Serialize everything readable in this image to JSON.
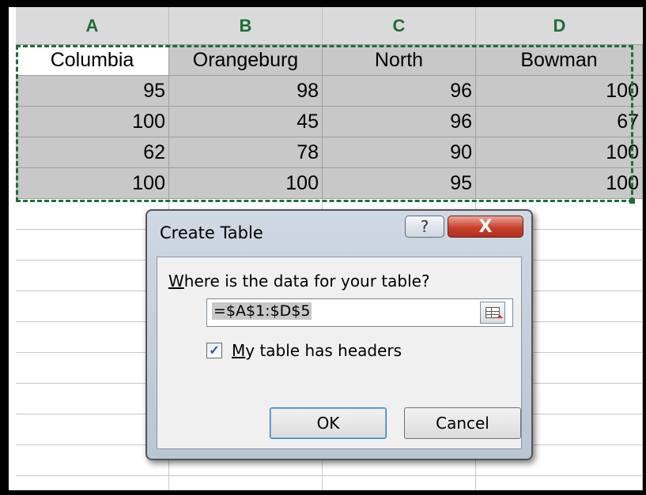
{
  "columns": [
    "A",
    "B",
    "C",
    "D"
  ],
  "table": {
    "headers": [
      "Columbia",
      "Orangeburg",
      "North",
      "Bowman"
    ],
    "rows": [
      [
        "95",
        "98",
        "96",
        "100"
      ],
      [
        "100",
        "45",
        "96",
        "67"
      ],
      [
        "62",
        "78",
        "90",
        "100"
      ],
      [
        "100",
        "100",
        "95",
        "100"
      ]
    ]
  },
  "dialog": {
    "title": "Create Table",
    "help_glyph": "?",
    "close_glyph": "X",
    "prompt_accel": "W",
    "prompt_rest": "here is the data for your table?",
    "range_value": "=$A$1:$D$5",
    "checkbox_checked": true,
    "checkbox_mark": "✓",
    "checkbox_label_accel": "M",
    "checkbox_label_rest": "y table has headers",
    "ok_label": "OK",
    "cancel_label": "Cancel"
  },
  "colors": {
    "accent_green": "#1e6e38",
    "selection_gray": "#c8c8c8",
    "close_red": "#c8402d"
  },
  "icons": {
    "help": "help-question-icon",
    "close": "close-x-icon",
    "collapse": "range-collapse-icon",
    "check": "checkmark-icon"
  }
}
